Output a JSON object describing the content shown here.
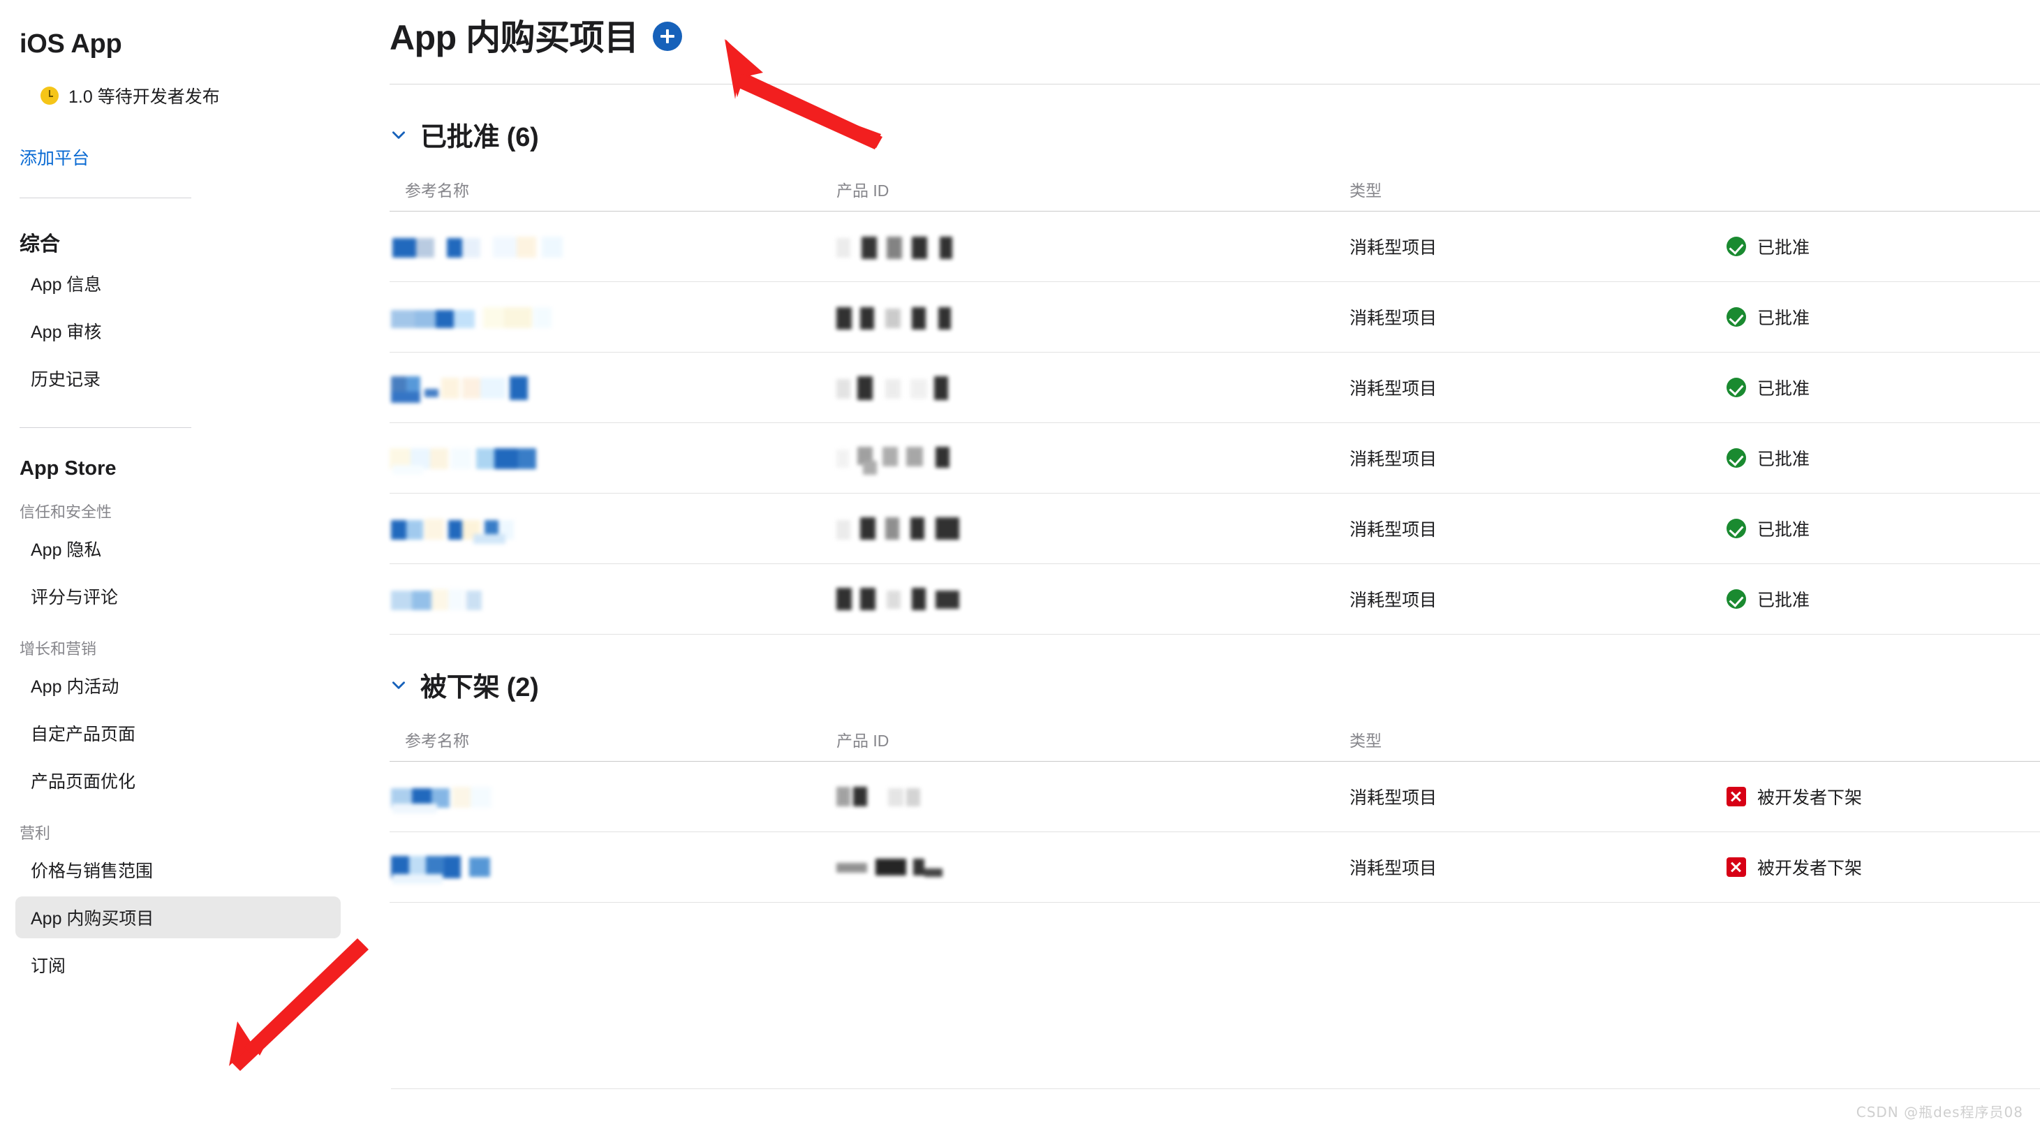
{
  "sidebar": {
    "app_title": "iOS App",
    "version_status": "1.0 等待开发者发布",
    "version_status_icon": "clock-icon",
    "add_platform_link": "添加平台",
    "groups": [
      {
        "title": "综合",
        "items": [
          {
            "label": "App 信息",
            "selected": false
          },
          {
            "label": "App 审核",
            "selected": false
          },
          {
            "label": "历史记录",
            "selected": false
          }
        ]
      },
      {
        "title": "App Store",
        "sections": [
          {
            "label": "信任和安全性",
            "items": [
              {
                "label": "App 隐私",
                "selected": false
              },
              {
                "label": "评分与评论",
                "selected": false
              }
            ]
          },
          {
            "label": "增长和营销",
            "items": [
              {
                "label": "App 内活动",
                "selected": false
              },
              {
                "label": "自定产品页面",
                "selected": false
              },
              {
                "label": "产品页面优化",
                "selected": false
              }
            ]
          },
          {
            "label": "营利",
            "items": [
              {
                "label": "价格与销售范围",
                "selected": false
              },
              {
                "label": "App 内购买项目",
                "selected": true
              },
              {
                "label": "订阅",
                "selected": false
              }
            ]
          }
        ]
      }
    ]
  },
  "main": {
    "page_title": "App 内购买项目",
    "add_button_icon": "plus-icon",
    "columns": {
      "name": "参考名称",
      "product_id": "产品 ID",
      "type": "类型",
      "state": ""
    },
    "sections": [
      {
        "title": "已批准 (6)",
        "chevron_icon": "chevron-down-icon",
        "rows": [
          {
            "name": "",
            "product_id": "",
            "type": "消耗型项目",
            "state": "已批准",
            "state_icon": "check-circle-icon",
            "redacted": true
          },
          {
            "name": "",
            "product_id": "",
            "type": "消耗型项目",
            "state": "已批准",
            "state_icon": "check-circle-icon",
            "redacted": true
          },
          {
            "name": "",
            "product_id": "",
            "type": "消耗型项目",
            "state": "已批准",
            "state_icon": "check-circle-icon",
            "redacted": true
          },
          {
            "name": "",
            "product_id": "",
            "type": "消耗型项目",
            "state": "已批准",
            "state_icon": "check-circle-icon",
            "redacted": true
          },
          {
            "name": "",
            "product_id": "",
            "type": "消耗型项目",
            "state": "已批准",
            "state_icon": "check-circle-icon",
            "redacted": true
          },
          {
            "name": "",
            "product_id": "",
            "type": "消耗型项目",
            "state": "已批准",
            "state_icon": "check-circle-icon",
            "redacted": true
          }
        ]
      },
      {
        "title": "被下架 (2)",
        "chevron_icon": "chevron-down-icon",
        "rows": [
          {
            "name": "",
            "product_id": "",
            "type": "消耗型项目",
            "state": "被开发者下架",
            "state_icon": "x-square-icon",
            "redacted": true
          },
          {
            "name": "",
            "product_id": "",
            "type": "消耗型项目",
            "state": "被开发者下架",
            "state_icon": "x-square-icon",
            "redacted": true
          }
        ]
      }
    ]
  },
  "annotations": {
    "arrow_color": "#f21f1f",
    "arrow_top_target": "add-button",
    "arrow_bottom_target": "sidebar-item-in-app-purchases"
  },
  "watermark": "CSDN @瓶des程序员08",
  "colors": {
    "accent_blue": "#1661ba",
    "link_blue": "#0b6bd3",
    "approved_green": "#1a8a30",
    "removed_red": "#d70015",
    "pending_yellow": "#f5c518",
    "selected_bg": "#e8e8e8"
  }
}
